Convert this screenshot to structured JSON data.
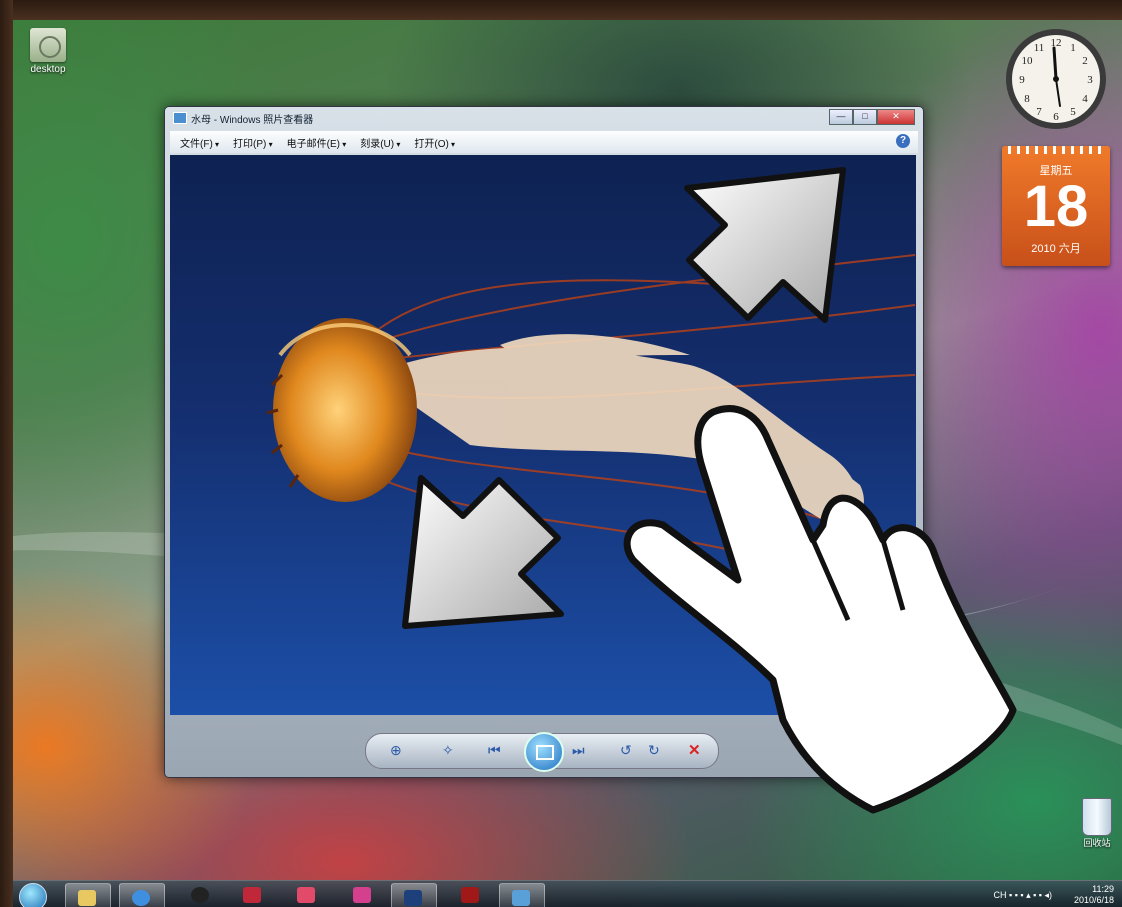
{
  "desktop": {
    "icon_label": "desktop"
  },
  "window": {
    "title": "水母 - Windows 照片查看器",
    "min_label": "—",
    "max_label": "□",
    "close_label": "✕",
    "menu": [
      "文件(F)",
      "打印(P)",
      "电子邮件(E)",
      "刻录(U)",
      "打开(O)"
    ],
    "help_label": "?"
  },
  "viewer_controls": {
    "zoom": "⊕",
    "fit": "✧",
    "prev": "⏮",
    "next": "⏭",
    "rotate_ccw": "↺",
    "rotate_cw": "↻",
    "delete": "✕"
  },
  "calendar": {
    "weekday": "星期五",
    "day": "18",
    "month": "2010 六月"
  },
  "recycle_bin": {
    "label": "回收站"
  },
  "taskbar": {
    "tray_text": "CH",
    "time": "11:29",
    "date": "2010/6/18"
  },
  "icons": [
    "start-orb",
    "explorer-icon",
    "ie-icon",
    "qq-icon",
    "shield-icon",
    "media-icon",
    "flower-icon",
    "photoshop-icon",
    "acrobat-icon",
    "photo-viewer-icon"
  ],
  "colors": {
    "calendar": "#e0621e",
    "window_frame": "#b8c4d0",
    "photo_bg": "#142e6e"
  }
}
